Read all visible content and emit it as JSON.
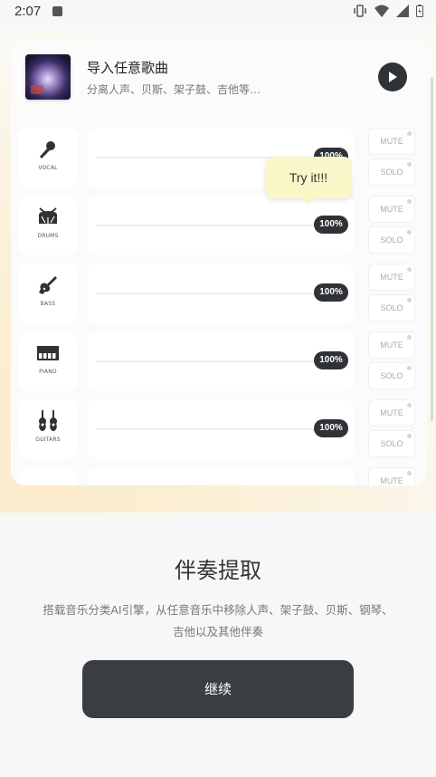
{
  "status_bar": {
    "time": "2:07"
  },
  "song": {
    "title": "导入任意歌曲",
    "subtitle": "分离人声、贝斯、架子鼓、吉他等…"
  },
  "tracks": [
    {
      "label": "VOCAL",
      "icon": "microphone-icon",
      "volume": "100%",
      "mute": "MUTE",
      "solo": "SOLO"
    },
    {
      "label": "DRUMS",
      "icon": "drum-icon",
      "volume": "100%",
      "mute": "MUTE",
      "solo": "SOLO"
    },
    {
      "label": "BASS",
      "icon": "bass-guitar-icon",
      "volume": "100%",
      "mute": "MUTE",
      "solo": "SOLO"
    },
    {
      "label": "PIANO",
      "icon": "piano-icon",
      "volume": "100%",
      "mute": "MUTE",
      "solo": "SOLO"
    },
    {
      "label": "GUITARS",
      "icon": "guitars-icon",
      "volume": "100%",
      "mute": "MUTE",
      "solo": "SOLO"
    },
    {
      "label": "",
      "icon": "other-icon",
      "volume": "",
      "mute": "MUTE",
      "solo": ""
    }
  ],
  "tooltip": {
    "text": "Try it!!!"
  },
  "feature": {
    "title": "伴奏提取",
    "description": "搭载音乐分类AI引擎，从任意音乐中移除人声、架子鼓、贝斯、钢琴、吉他以及其他伴奏"
  },
  "continue_button": {
    "label": "继续"
  },
  "colors": {
    "accent_dark": "#2f3236",
    "tooltip_bg": "#fbf6c8",
    "glow": "#fbeccb"
  }
}
